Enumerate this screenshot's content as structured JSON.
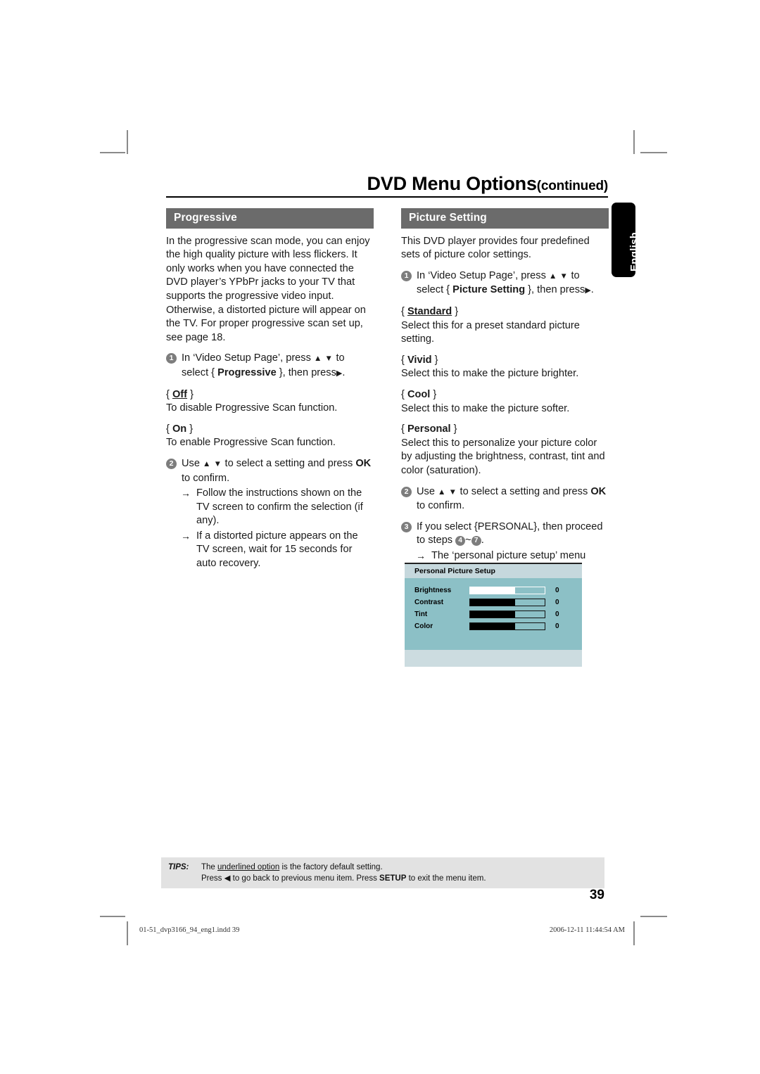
{
  "header": {
    "title": "DVD Menu Options",
    "continued": "(continued)",
    "side_tab": "English"
  },
  "left_column": {
    "section_title": "Progressive",
    "intro": "In the progressive scan mode, you can enjoy the high quality picture with less flickers. It only works when you have connected the DVD player’s YPbPr jacks to your TV that supports the progressive video input. Otherwise, a distorted picture will appear on the TV. For proper progressive scan set up, see page 18.",
    "step1_pre": "In ‘Video Setup Page’, press",
    "step1_updown": "▲ ▼",
    "step1_mid": "to select {",
    "step1_option": "Progressive",
    "step1_post": "}, then press",
    "step1_arrow": "▶",
    "step1_end": ".",
    "step1_num": "1",
    "options": [
      {
        "name": "Off",
        "underlined": true,
        "desc": "To disable Progressive Scan function."
      },
      {
        "name": "On",
        "underlined": false,
        "desc": "To enable Progressive Scan function."
      }
    ],
    "step2_num": "2",
    "step2_pre": "Use",
    "step2_updown": "▲ ▼",
    "step2_mid": "to select a setting and press",
    "step2_ok": "OK",
    "step2_post": "to confirm.",
    "step2_sub": [
      "Follow the instructions shown on the TV screen to confirm the selection (if any).",
      "If a distorted picture appears on the TV screen, wait for 15 seconds for auto recovery."
    ],
    "arrow_glyph": "→"
  },
  "right_column": {
    "section_title": "Picture Setting",
    "intro": "This DVD player provides four predefined sets of picture color settings.",
    "step1_num": "1",
    "step1_pre": "In ‘Video Setup Page’, press",
    "step1_updown": "▲ ▼",
    "step1_mid": "to select {",
    "step1_option": "Picture Setting",
    "step1_post": "}, then press",
    "step1_arrow": "▶",
    "step1_end": ".",
    "options": [
      {
        "name": "Standard",
        "underlined": true,
        "desc": "Select this for a preset standard picture setting."
      },
      {
        "name": "Vivid",
        "underlined": false,
        "desc": "Select this to make the picture brighter."
      },
      {
        "name": "Cool",
        "underlined": false,
        "desc": "Select this to make the picture softer."
      },
      {
        "name": "Personal",
        "underlined": false,
        "desc": "Select this to personalize your picture color by adjusting the brightness, contrast, tint and color (saturation)."
      }
    ],
    "step2_num": "2",
    "step2_pre": "Use",
    "step2_updown": "▲ ▼",
    "step2_mid": "to select a setting and press",
    "step2_ok": "OK",
    "step2_post": "to confirm.",
    "step3_num": "3",
    "step3_pre": "If you select {PERSONAL}, then proceed to steps",
    "step3_from": "4",
    "step3_tilde": "~",
    "step3_to": "7",
    "step3_end": ".",
    "step3_sub": "The ‘personal picture setup’ menu appears.",
    "arrow_glyph": "→"
  },
  "osd_menu": {
    "title": "Personal Picture Setup",
    "rows": [
      {
        "label": "Brightness",
        "value": "0",
        "fill_percent": 60,
        "selected": true
      },
      {
        "label": "Contrast",
        "value": "0",
        "fill_percent": 60,
        "selected": false
      },
      {
        "label": "Tint",
        "value": "0",
        "fill_percent": 60,
        "selected": false
      },
      {
        "label": "Color",
        "value": "0",
        "fill_percent": 60,
        "selected": false
      }
    ],
    "colors": {
      "background": "#8cc0c6",
      "header": "#c6d8dd",
      "footer": "#ccdce0"
    }
  },
  "tips": {
    "label": "TIPS:",
    "line1_pre": "The ",
    "line1_underlined": "underlined option",
    "line1_post": " is the factory default setting.",
    "line2_pre": "Press ",
    "line2_arrow": "◀",
    "line2_mid": " to go back to previous menu item. Press ",
    "line2_bold": "SETUP",
    "line2_post": " to exit the menu item."
  },
  "page_number": "39",
  "imprint": {
    "left": "01-51_dvp3166_94_eng1.indd   39",
    "right": "2006-12-11   11:44:54 AM"
  },
  "colors": {
    "section_bar": "#6b6b6b",
    "bullet": "#7d7d7d",
    "tips_bg": "#e2e2e2"
  }
}
